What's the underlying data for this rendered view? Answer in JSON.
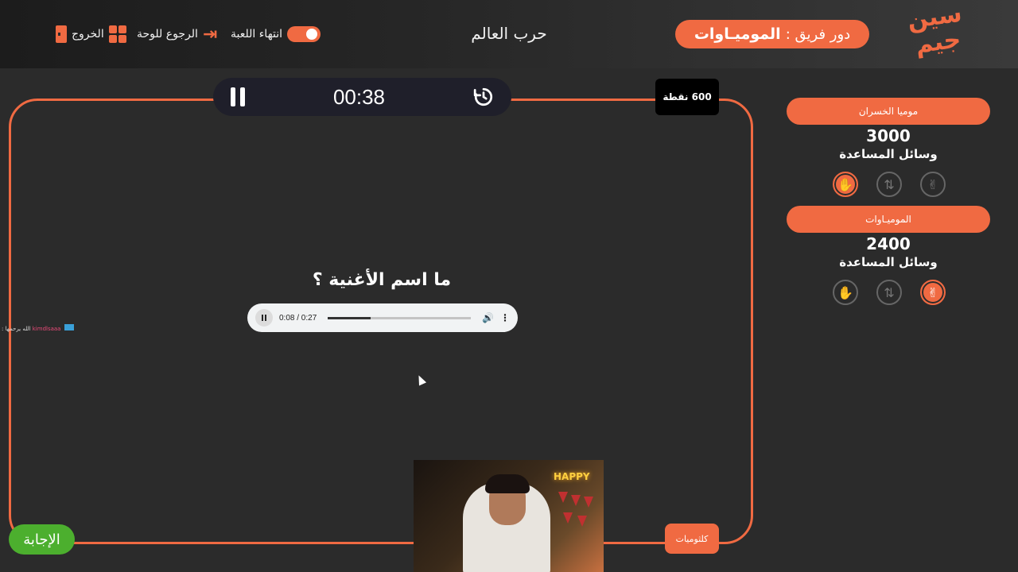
{
  "header": {
    "logo_text": "سين جيم",
    "turn_prefix": "دور فريق :",
    "turn_team": "الموميـاوات",
    "game_title": "حرب العالم",
    "end_game_label": "انتهاء اللعبة",
    "back_to_board_label": "الرجوع للوحة",
    "exit_label": "الخروج"
  },
  "question": {
    "timer": "00:38",
    "points": "600 نقطة",
    "text": "ما اسم الأغنية ؟",
    "audio": {
      "current": "0:08",
      "duration": "0:27",
      "time_display": "0:08 / 0:27",
      "progress": 0.3
    },
    "category": "كلثوميات",
    "answer_label": "الإجابة"
  },
  "chat": {
    "user": "kimdlsaaa",
    "message": "الله يرحمها :"
  },
  "webcam": {
    "neon_text": "HAPPY"
  },
  "teams": [
    {
      "name": "موميا الخسران",
      "score": "3000",
      "helps_label": "وسائل المساعدة",
      "helps": [
        {
          "icon": "hand-stop-icon",
          "active": true
        },
        {
          "icon": "swap-icon",
          "active": false
        },
        {
          "icon": "peace-hand-icon",
          "active": false
        }
      ]
    },
    {
      "name": "الموميـاوات",
      "score": "2400",
      "helps_label": "وسائل المساعدة",
      "helps": [
        {
          "icon": "hand-stop-icon",
          "active": false
        },
        {
          "icon": "swap-icon",
          "active": false
        },
        {
          "icon": "peace-hand-icon",
          "active": true
        }
      ]
    }
  ],
  "colors": {
    "accent": "#f06a42",
    "answer": "#4caf2e",
    "background": "#2b2b2b"
  }
}
